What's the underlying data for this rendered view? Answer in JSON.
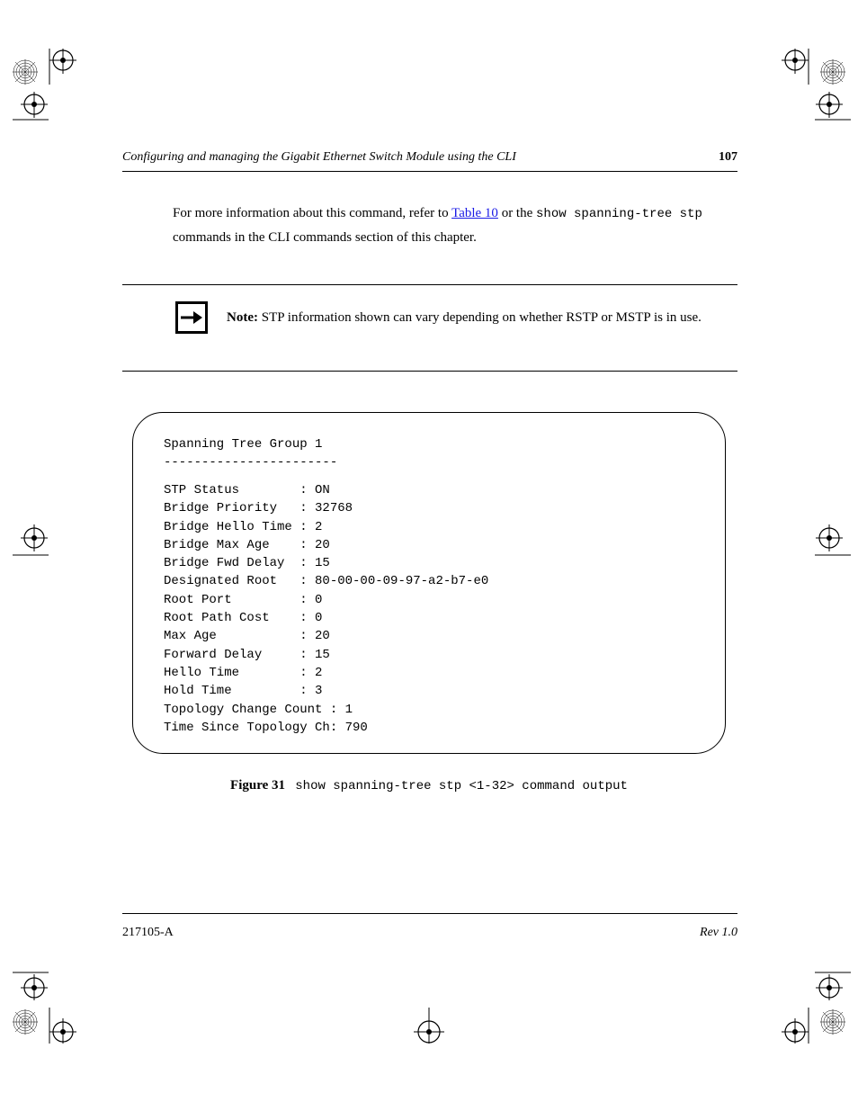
{
  "header": {
    "running": "Configuring and managing the Gigabit Ethernet Switch Module using the CLI",
    "page": "107"
  },
  "paragraph": {
    "pre": "For more information about this command, refer to ",
    "link_text": "Table 10",
    "post_link": " or the show ",
    "mono1": "spanning-tree",
    "post_link2": " or the ",
    "mono2": "show spanning-tree stp",
    "post": " commands in the CLI commands section of this chapter."
  },
  "note": {
    "lead": "Note:",
    "body": "  STP information shown can vary depending on whether RSTP or MSTP is in use."
  },
  "figure": {
    "title": "Spanning Tree Group 1\n-----------------------",
    "body": "STP Status        : ON\nBridge Priority   : 32768\nBridge Hello Time : 2\nBridge Max Age    : 20\nBridge Fwd Delay  : 15\nDesignated Root   : 80-00-00-09-97-a2-b7-e0\nRoot Port         : 0\nRoot Path Cost    : 0\nMax Age           : 20\nForward Delay     : 15\nHello Time        : 2\nHold Time         : 3\nTopology Change Count : 1\nTime Since Topology Ch: 790"
  },
  "caption": {
    "label": "Figure 31",
    "text": "show spanning-tree stp <1-32>  command output"
  },
  "footer": {
    "left": "217105-A",
    "right": "Rev 1.0"
  }
}
